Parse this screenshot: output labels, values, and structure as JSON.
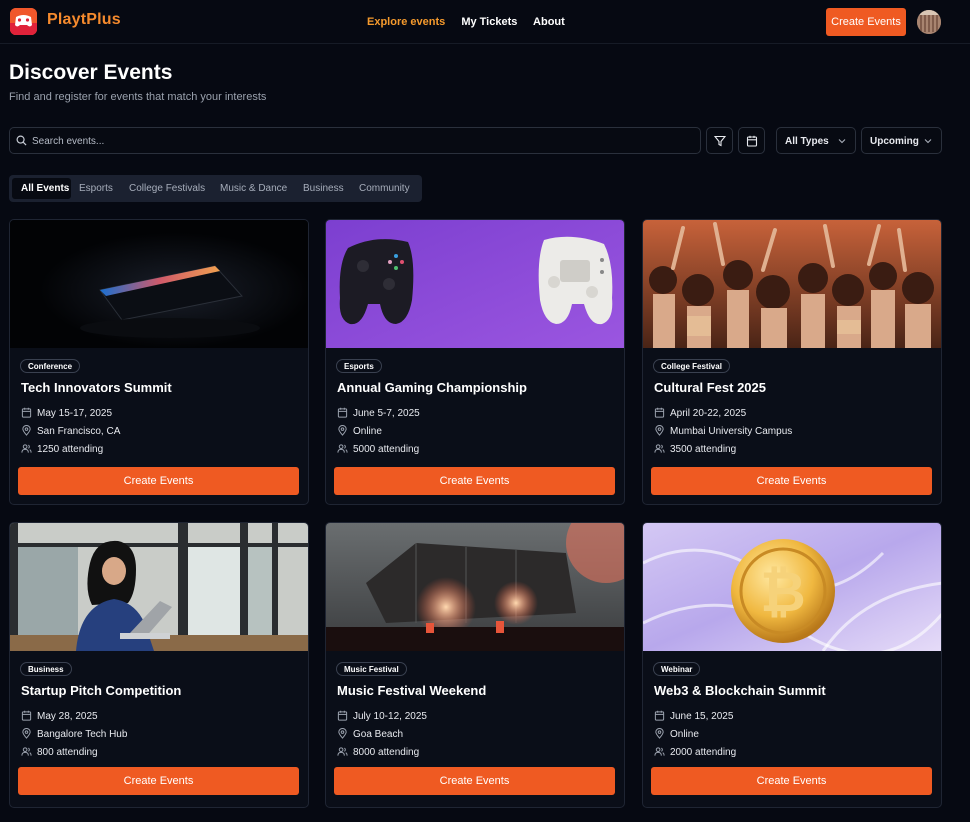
{
  "brand": {
    "name": "PlaytPlus"
  },
  "nav": {
    "links": [
      {
        "label": "Explore events"
      },
      {
        "label": "My Tickets"
      },
      {
        "label": "About"
      }
    ],
    "create_label": "Create Events"
  },
  "header": {
    "title": "Discover Events",
    "subtitle": "Find and register for events that match your interests"
  },
  "search": {
    "placeholder": "Search events..."
  },
  "filters": {
    "type": "All Types",
    "time": "Upcoming"
  },
  "tabs": [
    {
      "label": "All Events"
    },
    {
      "label": "Esports"
    },
    {
      "label": "College Festivals"
    },
    {
      "label": "Music & Dance"
    },
    {
      "label": "Business"
    },
    {
      "label": "Community"
    }
  ],
  "events": [
    {
      "badge": "Conference",
      "title": "Tech Innovators Summit",
      "date": "May 15-17, 2025",
      "location": "San Francisco, CA",
      "attendees": "1250 attending",
      "cta": "Create Events"
    },
    {
      "badge": "Esports",
      "title": "Annual Gaming Championship",
      "date": "June 5-7, 2025",
      "location": "Online",
      "attendees": "5000 attending",
      "cta": "Create Events"
    },
    {
      "badge": "College Festival",
      "title": "Cultural Fest 2025",
      "date": "April 20-22, 2025",
      "location": "Mumbai University Campus",
      "attendees": "3500 attending",
      "cta": "Create Events"
    },
    {
      "badge": "Business",
      "title": "Startup Pitch Competition",
      "date": "May 28, 2025",
      "location": "Bangalore Tech Hub",
      "attendees": "800 attending",
      "cta": "Create Events"
    },
    {
      "badge": "Music Festival",
      "title": "Music Festival Weekend",
      "date": "July 10-12, 2025",
      "location": "Goa Beach",
      "attendees": "8000 attending",
      "cta": "Create Events"
    },
    {
      "badge": "Webinar",
      "title": "Web3 & Blockchain Summit",
      "date": "June 15, 2025",
      "location": "Online",
      "attendees": "2000 attending",
      "cta": "Create Events"
    }
  ],
  "colors": {
    "accent": "#ef5a22",
    "brand": "#f58a2d",
    "background": "#060912"
  }
}
